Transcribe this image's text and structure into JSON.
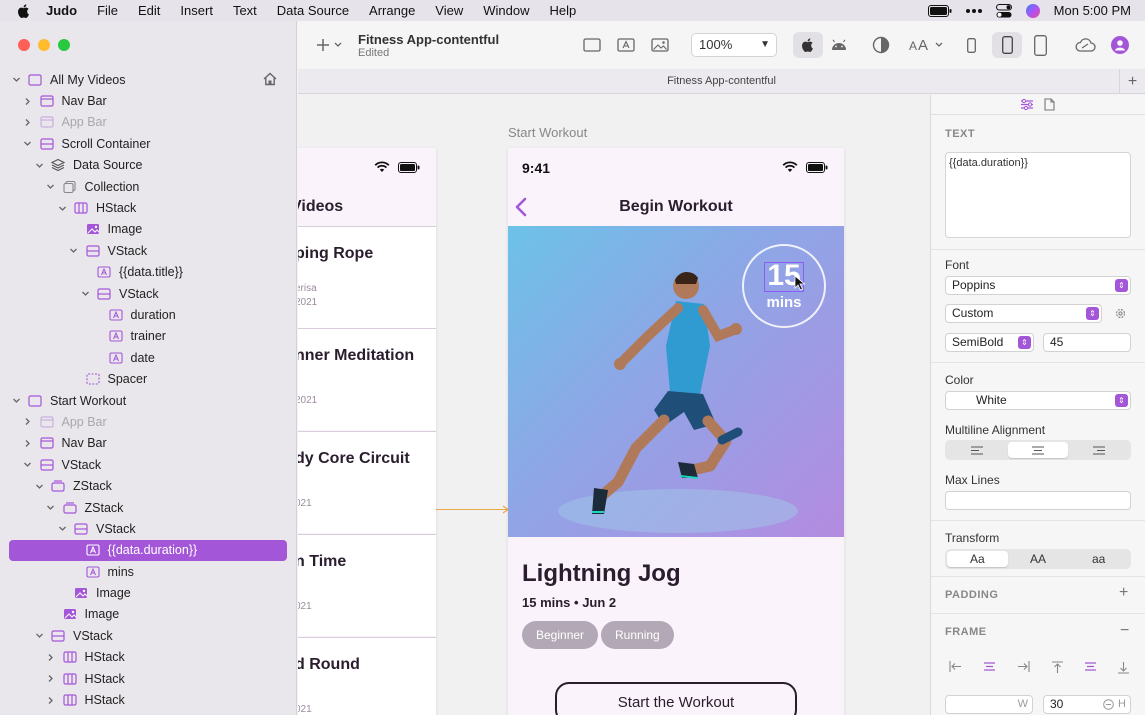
{
  "menubar": {
    "app_name": "Judo",
    "items": [
      "File",
      "Edit",
      "Insert",
      "Text",
      "Data Source",
      "Arrange",
      "View",
      "Window",
      "Help"
    ],
    "clock": "Mon 5:00 PM"
  },
  "toolbar": {
    "doc_title": "Fitness App-contentful",
    "doc_status": "Edited",
    "zoom": "100%",
    "tab_title": "Fitness App-contentful"
  },
  "sidebar": {
    "items": [
      {
        "label": "All My Videos",
        "indent": 0,
        "chev": "down",
        "icon": "screen-icon",
        "dim": false
      },
      {
        "label": "Nav Bar",
        "indent": 1,
        "chev": "right",
        "icon": "navbar-icon",
        "dim": false
      },
      {
        "label": "App Bar",
        "indent": 1,
        "chev": "right",
        "icon": "appbar-icon",
        "dim": true
      },
      {
        "label": "Scroll Container",
        "indent": 1,
        "chev": "down",
        "icon": "scroll-icon",
        "dim": false
      },
      {
        "label": "Data Source",
        "indent": 2,
        "chev": "down",
        "icon": "datasource-icon",
        "dim": false
      },
      {
        "label": "Collection",
        "indent": 3,
        "chev": "down",
        "icon": "collection-icon",
        "dim": false
      },
      {
        "label": "HStack",
        "indent": 4,
        "chev": "down",
        "icon": "hstack-icon",
        "dim": false
      },
      {
        "label": "Image",
        "indent": 5,
        "chev": "none",
        "icon": "image-icon",
        "dim": false
      },
      {
        "label": "VStack",
        "indent": 5,
        "chev": "down",
        "icon": "vstack-icon",
        "dim": false
      },
      {
        "label": "{{data.title}}",
        "indent": 6,
        "chev": "none",
        "icon": "text-icon",
        "dim": false
      },
      {
        "label": "VStack",
        "indent": 6,
        "chev": "down",
        "icon": "vstack-icon",
        "dim": false
      },
      {
        "label": "duration",
        "indent": 7,
        "chev": "none",
        "icon": "text-icon",
        "dim": false
      },
      {
        "label": "trainer",
        "indent": 7,
        "chev": "none",
        "icon": "text-icon",
        "dim": false
      },
      {
        "label": "date",
        "indent": 7,
        "chev": "none",
        "icon": "text-icon",
        "dim": false
      },
      {
        "label": "Spacer",
        "indent": 5,
        "chev": "none",
        "icon": "spacer-icon",
        "dim": false
      },
      {
        "label": "Start Workout",
        "indent": 0,
        "chev": "down",
        "icon": "screen-icon",
        "dim": false
      },
      {
        "label": "App Bar",
        "indent": 1,
        "chev": "right",
        "icon": "appbar-icon",
        "dim": true
      },
      {
        "label": "Nav Bar",
        "indent": 1,
        "chev": "right",
        "icon": "navbar-icon",
        "dim": false
      },
      {
        "label": "VStack",
        "indent": 1,
        "chev": "down",
        "icon": "vstack-icon",
        "dim": false
      },
      {
        "label": "ZStack",
        "indent": 2,
        "chev": "down",
        "icon": "zstack-icon",
        "dim": false
      },
      {
        "label": "ZStack",
        "indent": 3,
        "chev": "down",
        "icon": "zstack-icon",
        "dim": false
      },
      {
        "label": "VStack",
        "indent": 4,
        "chev": "down",
        "icon": "vstack-icon",
        "dim": false
      },
      {
        "label": "{{data.duration}}",
        "indent": 5,
        "chev": "none",
        "icon": "text-icon",
        "dim": false,
        "selected": true
      },
      {
        "label": "mins",
        "indent": 5,
        "chev": "none",
        "icon": "text-icon",
        "dim": false
      },
      {
        "label": "Image",
        "indent": 4,
        "chev": "none",
        "icon": "image-icon",
        "dim": false
      },
      {
        "label": "Image",
        "indent": 3,
        "chev": "none",
        "icon": "image-icon",
        "dim": false
      },
      {
        "label": "VStack",
        "indent": 2,
        "chev": "down",
        "icon": "vstack-icon",
        "dim": false
      },
      {
        "label": "HStack",
        "indent": 3,
        "chev": "right",
        "icon": "hstack-icon",
        "dim": false
      },
      {
        "label": "HStack",
        "indent": 3,
        "chev": "right",
        "icon": "hstack-icon",
        "dim": false
      },
      {
        "label": "HStack",
        "indent": 3,
        "chev": "right",
        "icon": "hstack-icon",
        "dim": false
      }
    ]
  },
  "canvas": {
    "screen_label": "Start Workout",
    "left_phone": {
      "header_title": "Videos",
      "cells": [
        {
          "title": "ping Rope",
          "sub": "erisa",
          "date": "2021"
        },
        {
          "title": "nner Meditation",
          "sub": "",
          "date": "2021"
        },
        {
          "title": "dy Core Circuit",
          "sub": "",
          "date": "021"
        },
        {
          "title": "n Time",
          "sub": "",
          "date": "021"
        },
        {
          "title": "d Round",
          "sub": "",
          "date": "021"
        }
      ]
    },
    "main_phone": {
      "time": "9:41",
      "nav_title": "Begin Workout",
      "badge_number": "15",
      "badge_unit": "mins",
      "workout_title": "Lightning Jog",
      "workout_meta": "15 mins • Jun 2",
      "chips": [
        "Beginner",
        "Running"
      ],
      "cta": "Start the Workout"
    }
  },
  "inspector": {
    "text_section": "TEXT",
    "text_value": "{{data.duration}}",
    "font_label": "Font",
    "font_family": "Poppins",
    "font_size_mode": "Custom",
    "font_weight": "SemiBold",
    "font_size": "45",
    "color_label": "Color",
    "color_value": "White",
    "alignment_label": "Multiline Alignment",
    "max_lines_label": "Max Lines",
    "transform_label": "Transform",
    "transform_options": [
      "Aa",
      "AA",
      "aa"
    ],
    "padding_section": "PADDING",
    "frame_section": "FRAME",
    "frame_w_label": "W",
    "frame_h_value": "30",
    "frame_h_label": "H"
  },
  "colors": {
    "accent": "#a456d8",
    "ink": "#2a1d2e",
    "chip": "#b3a8b6"
  }
}
